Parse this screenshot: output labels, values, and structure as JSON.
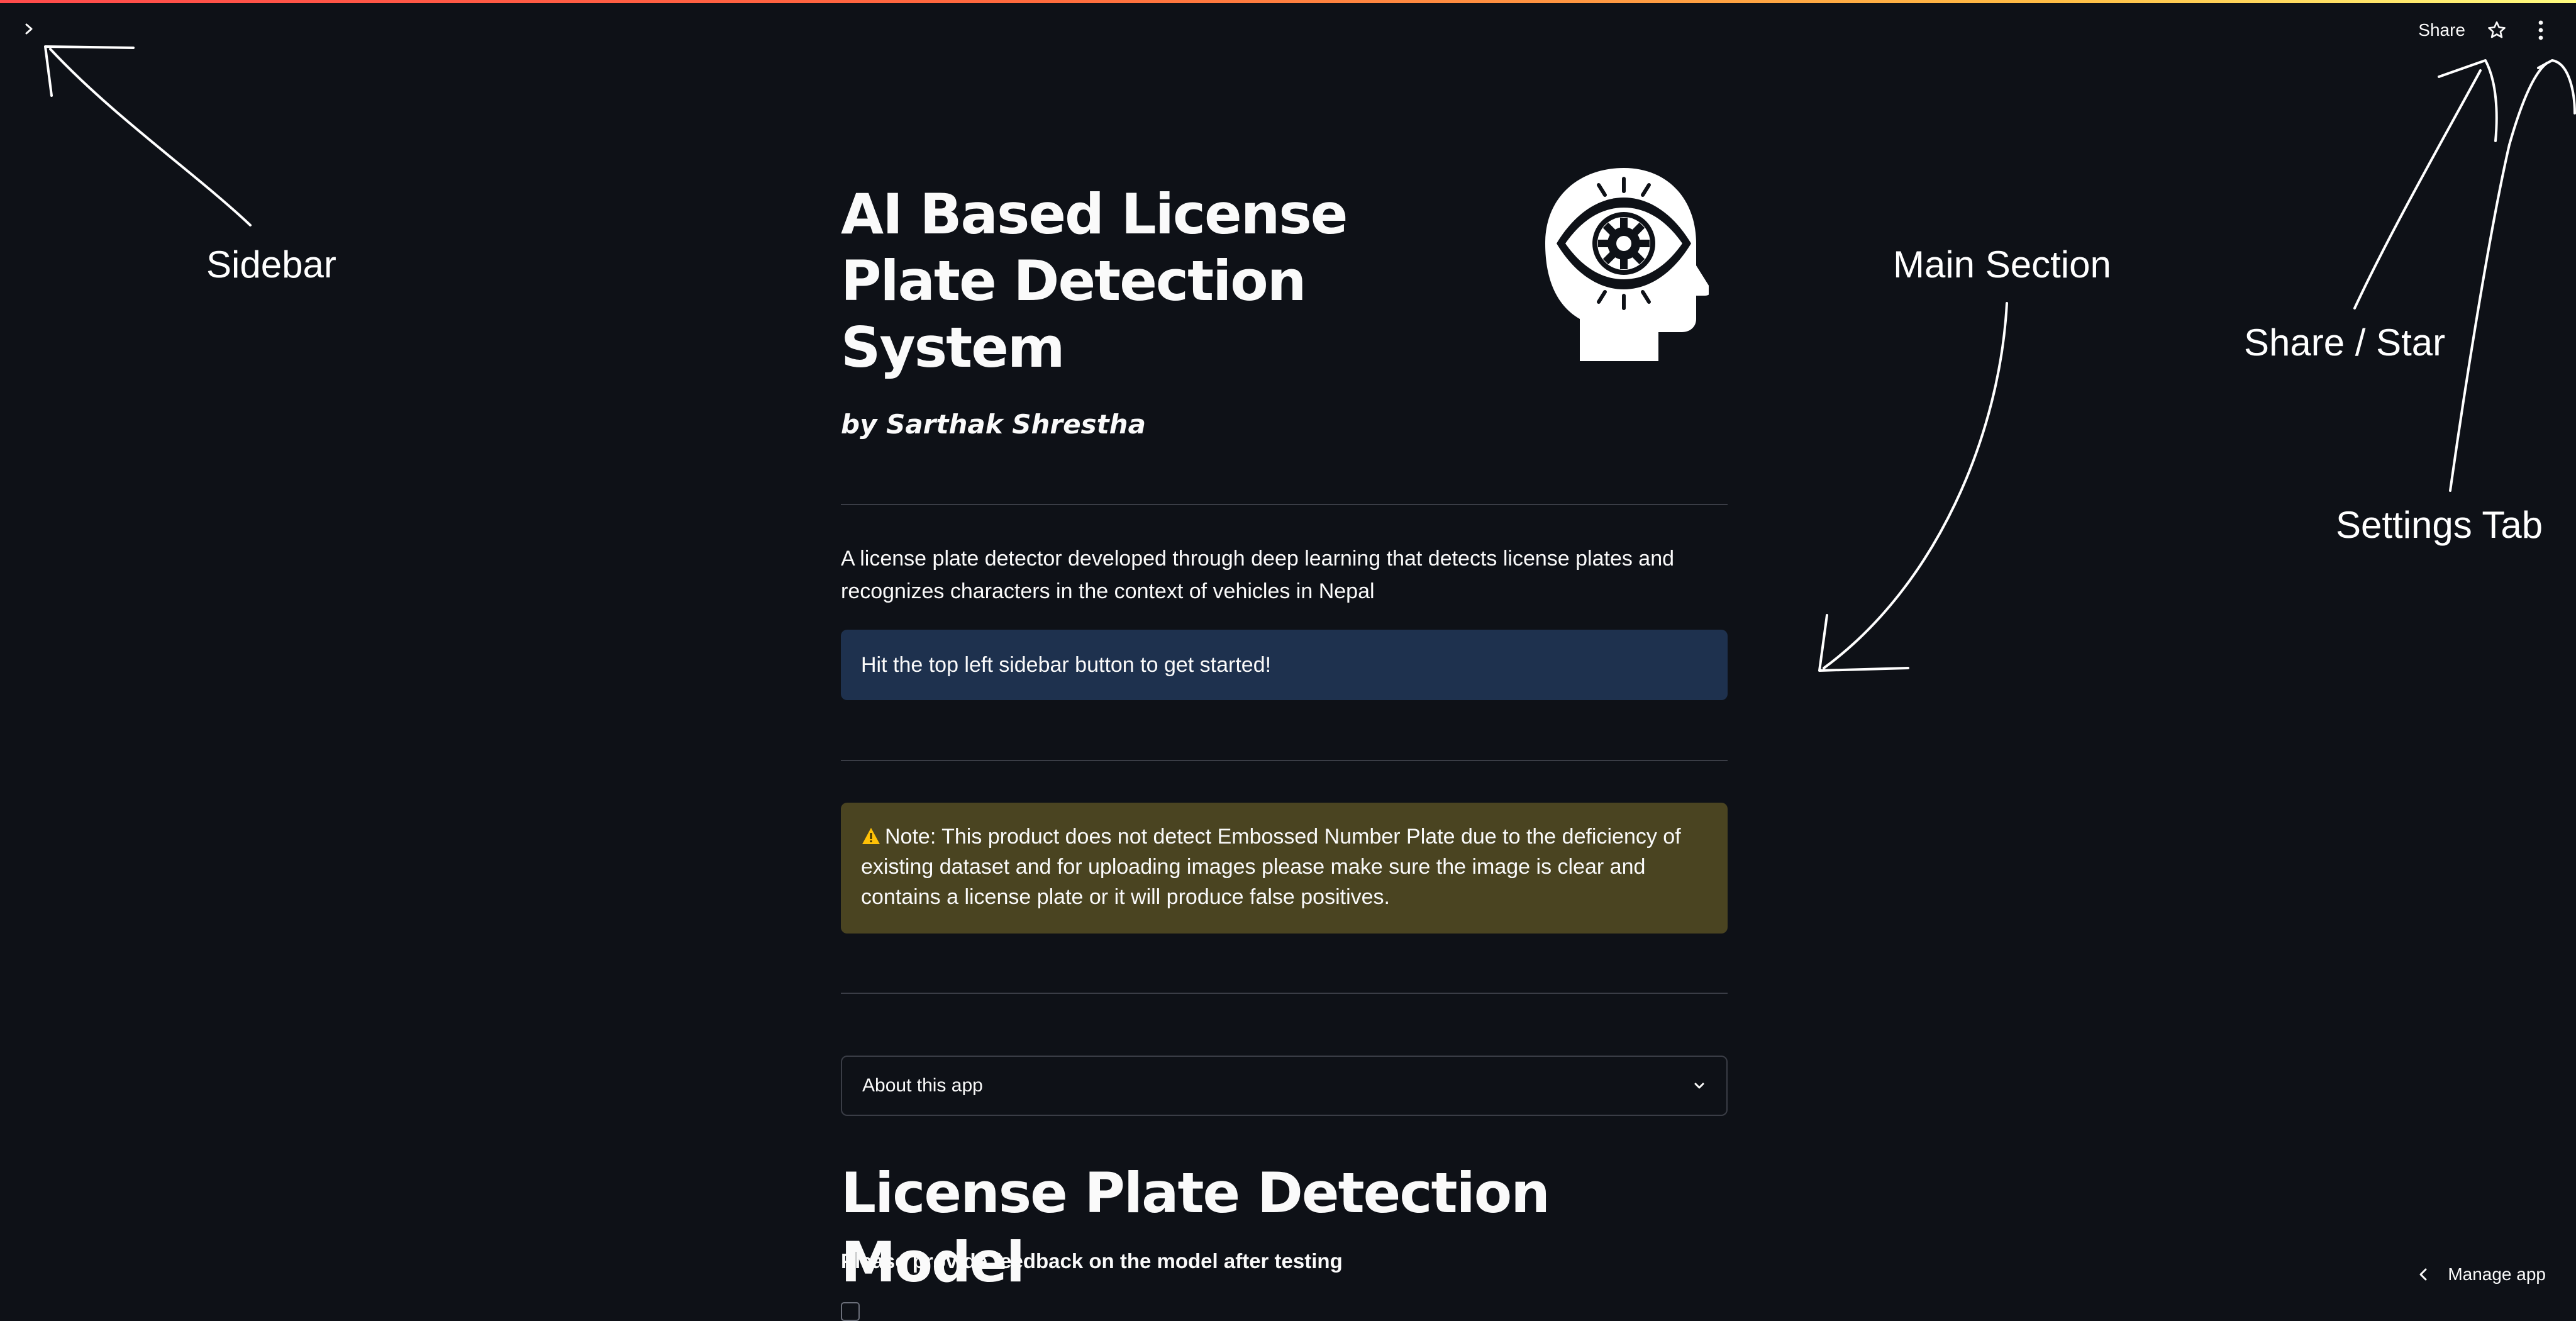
{
  "header": {
    "share_label": "Share",
    "icons": [
      "chevron-right-icon",
      "star-icon",
      "more-vertical-icon"
    ]
  },
  "main": {
    "title": "AI Based License Plate Detection System",
    "logo_icon": "head-gear-eye-icon",
    "byline": "by Sarthak Shrestha",
    "description": "A license plate detector developed through deep learning that detects license plates and recognizes characters in the context of vehicles in Nepal",
    "info_message": "Hit the top left sidebar button to get started!",
    "warning_message": "Note: This product does not detect Embossed Number Plate due to the deficiency of existing dataset and for uploading images please make sure the image is clear and contains a license plate or it will produce false positives.",
    "expander_label": "About this app",
    "section_title": "License Plate Detection Model",
    "feedback_text": "Please provide feedback on the model after testing"
  },
  "footer": {
    "manage_app_label": "Manage app"
  },
  "annotations": {
    "sidebar": "Sidebar",
    "main_section": "Main Section",
    "share_star": "Share / Star",
    "settings_tab": "Settings Tab"
  },
  "colors": {
    "background": "#0e1117",
    "text": "#fafafa",
    "info_bg": "#1e314e",
    "warning_bg": "#4a4421",
    "divider": "#3a3d46",
    "top_gradient_start": "#ff4b4b",
    "top_gradient_end": "#fffd80"
  }
}
